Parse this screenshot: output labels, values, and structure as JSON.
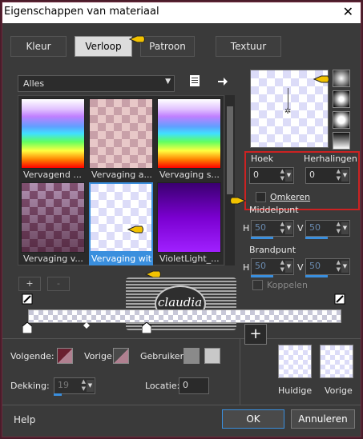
{
  "window": {
    "title": "Eigenschappen van materiaal",
    "close": "✕"
  },
  "tabs": [
    {
      "label": "Kleur"
    },
    {
      "label": "Verloop"
    },
    {
      "label": "Patroon"
    },
    {
      "label": "Textuur"
    }
  ],
  "category": {
    "value": "Alles",
    "arrow": "▼"
  },
  "gallery": {
    "items": [
      {
        "label": "Vervagend ..."
      },
      {
        "label": "Vervaging a..."
      },
      {
        "label": "Vervaging s..."
      },
      {
        "label": "Vervaging v..."
      },
      {
        "label": "Vervaging wit"
      },
      {
        "label": "VioletLight_..."
      }
    ]
  },
  "buttons": {
    "add": "+",
    "remove": "-",
    "ok": "OK",
    "cancel": "Annuleren",
    "help": "Help",
    "add_material": "+"
  },
  "angle": {
    "label": "Hoek",
    "value": "0"
  },
  "repeats": {
    "label": "Herhalingen",
    "value": "0"
  },
  "invert": {
    "label": "Omkeren"
  },
  "center": {
    "label": "Middelpunt",
    "h_label": "H",
    "h": "50",
    "v_label": "V",
    "v": "50"
  },
  "focal": {
    "label": "Brandpunt",
    "h_label": "H",
    "h": "50",
    "v_label": "V",
    "v": "50"
  },
  "link": {
    "label": "Koppelen"
  },
  "bottom": {
    "next_label": "Volgende:",
    "prev_label": "Vorige:",
    "user_label": "Gebruiker:",
    "opacity_label": "Dekking:",
    "opacity": "19",
    "location_label": "Locatie:",
    "location": "0",
    "current_label": "Huidige",
    "previous_label": "Vorige"
  },
  "colors": {
    "accent": "#3a8fde",
    "highlight_red": "#cc2222",
    "next_swatch": "#6a2030",
    "prev_swatch": "#b08090"
  },
  "watermark": {
    "text": "claudia"
  }
}
